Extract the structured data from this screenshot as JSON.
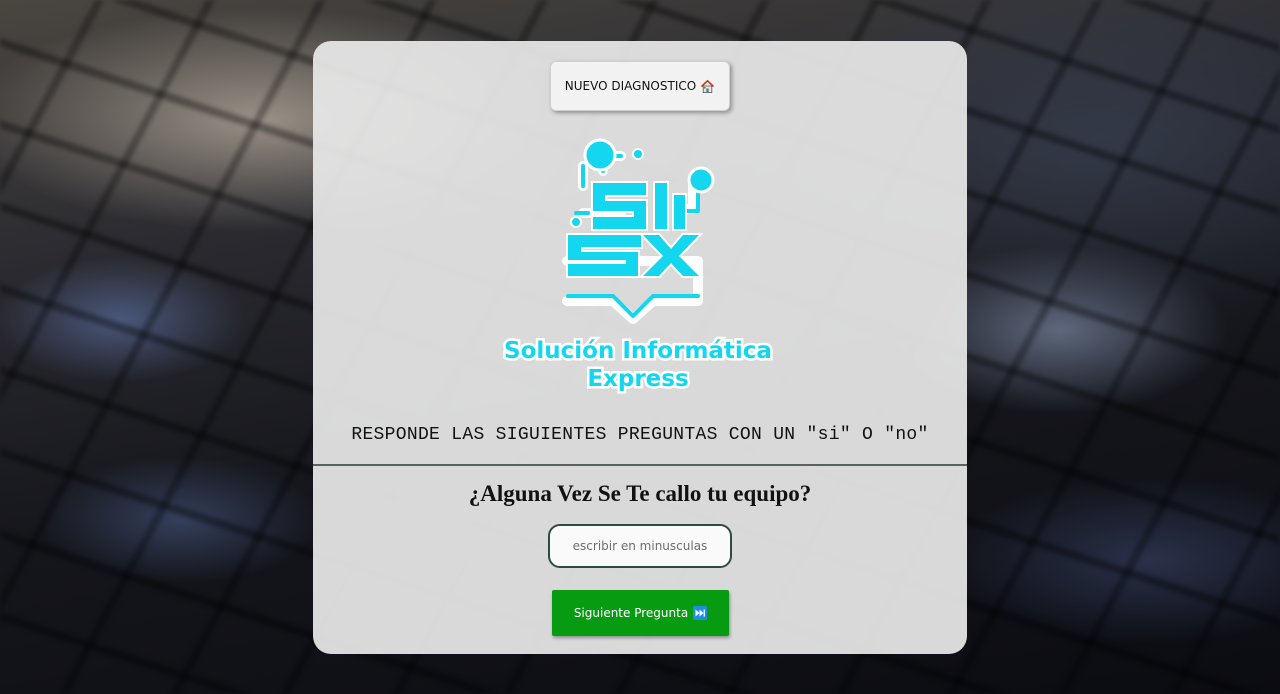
{
  "header": {
    "new_diagnosis_label": "NUEVO DIAGNOSTICO",
    "new_diagnosis_icon": "house-icon"
  },
  "logo": {
    "mark_text": "SI EX",
    "line1": "Solución Informática",
    "line2": "Express",
    "color": "#14d6ee"
  },
  "instructions": "RESPONDE LAS SIGUIENTES PREGUNTAS CON UN \"si\" O \"no\"",
  "question": "¿Alguna Vez Se Te callo tu equipo?",
  "answer": {
    "value": "",
    "placeholder": "escribir en minusculas"
  },
  "next_button": {
    "label": "Siguiente Pregunta",
    "icon": "fast-forward-icon",
    "color": "#079b12"
  }
}
